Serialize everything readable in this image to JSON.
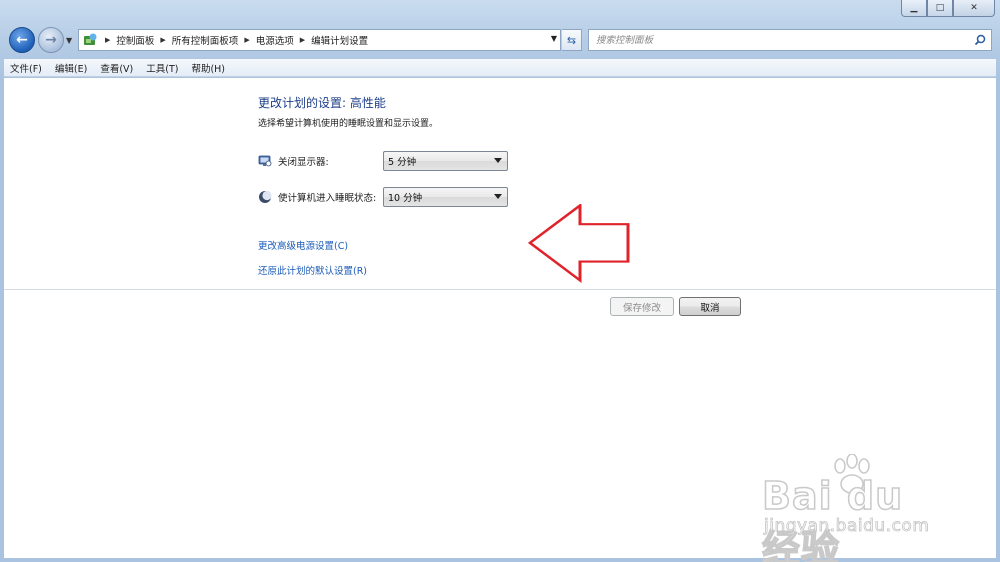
{
  "window": {
    "minimize_glyph": "▁",
    "maximize_glyph": "□",
    "close_glyph": "✕"
  },
  "address_bar": {
    "breadcrumbs": [
      "控制面板",
      "所有控制面板项",
      "电源选项",
      "编辑计划设置"
    ],
    "icon": "control-panel-icon",
    "dropdown_glyph": "▼",
    "refresh_glyph": "⇆"
  },
  "search": {
    "placeholder": "搜索控制面板"
  },
  "menu": {
    "items": [
      "文件(F)",
      "编辑(E)",
      "查看(V)",
      "工具(T)",
      "帮助(H)"
    ]
  },
  "page": {
    "title": "更改计划的设置: 高性能",
    "subtitle": "选择希望计算机使用的睡眠设置和显示设置。"
  },
  "settings": [
    {
      "label": "关闭显示器:",
      "value": "5 分钟",
      "icon": "monitor-icon"
    },
    {
      "label": "使计算机进入睡眠状态:",
      "value": "10 分钟",
      "icon": "moon-icon"
    }
  ],
  "links": {
    "advanced": "更改高级电源设置(C)",
    "restore": "还原此计划的默认设置(R)"
  },
  "buttons": {
    "save": "保存修改",
    "cancel": "取消"
  },
  "colors": {
    "title": "#1d3f8a",
    "link": "#1a5bb8",
    "arrow": "#e0232b"
  }
}
